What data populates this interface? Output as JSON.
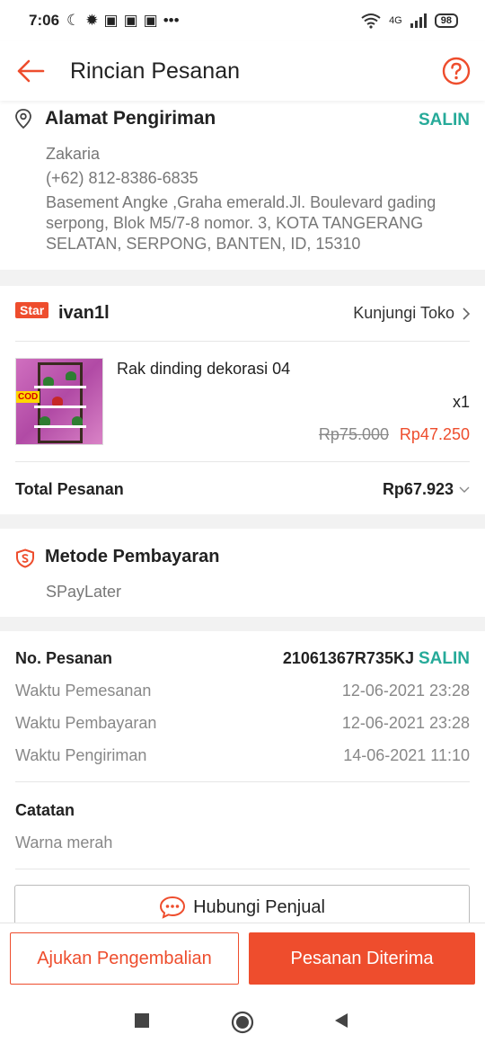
{
  "status_bar": {
    "time": "7:06",
    "network": "4G",
    "battery": "98"
  },
  "header": {
    "title": "Rincian Pesanan"
  },
  "address": {
    "heading": "Alamat Pengiriman",
    "copy_label": "SALIN",
    "name": "Zakaria",
    "phone": "(+62) 812-8386-6835",
    "line1": "Basement Angke ,Graha emerald.Jl. Boulevard gading",
    "line2": "serpong, Blok M5/7-8 nomor. 3, KOTA TANGERANG",
    "line3": "SELATAN, SERPONG, BANTEN, ID, 15310"
  },
  "shop": {
    "badge": "Star",
    "name": "ivan1l",
    "visit_label": "Kunjungi Toko",
    "product": {
      "thumb_badge": "COD",
      "name": "Rak dinding dekorasi 04",
      "quantity": "x1",
      "original_price": "Rp75.000",
      "price": "Rp47.250"
    },
    "total_label": "Total Pesanan",
    "total_value": "Rp67.923"
  },
  "payment": {
    "heading": "Metode Pembayaran",
    "method": "SPayLater"
  },
  "order_info": {
    "order_no_label": "No. Pesanan",
    "order_no": "21061367R735KJ",
    "copy_label": "SALIN",
    "rows": [
      {
        "label": "Waktu Pemesanan",
        "value": "12-06-2021 23:28"
      },
      {
        "label": "Waktu Pembayaran",
        "value": "12-06-2021 23:28"
      },
      {
        "label": "Waktu Pengiriman",
        "value": "14-06-2021 11:10"
      }
    ],
    "note_label": "Catatan",
    "note_value": "Warna merah",
    "contact_button": "Hubungi Penjual"
  },
  "actions": {
    "return_label": "Ajukan Pengembalian",
    "received_label": "Pesanan Diterima"
  },
  "colors": {
    "accent": "#ee4d2d",
    "copy": "#26aa99"
  }
}
